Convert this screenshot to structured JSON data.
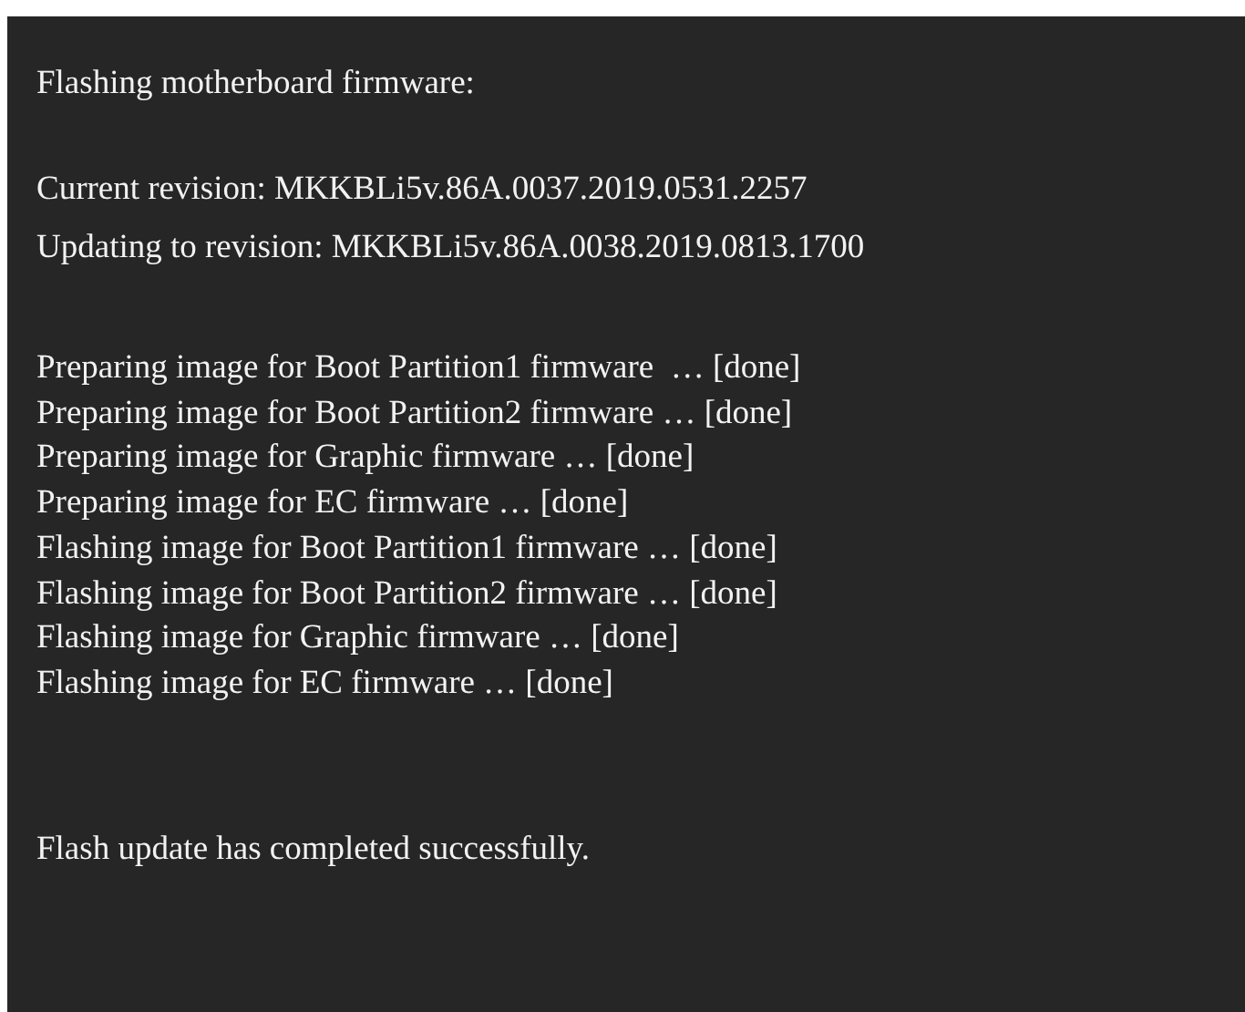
{
  "title": "Flashing motherboard firmware:",
  "revisions": [
    "Current revision: MKKBLi5v.86A.0037.2019.0531.2257",
    "Updating to revision: MKKBLi5v.86A.0038.2019.0813.1700"
  ],
  "steps": [
    "Preparing image for Boot Partition1 firmware  … [done]",
    "Preparing image for Boot Partition2 firmware … [done]",
    "Preparing image for Graphic firmware … [done]",
    "Preparing image for EC firmware … [done]",
    "Flashing image for Boot Partition1 firmware … [done]",
    "Flashing image for Boot Partition2 firmware … [done]",
    "Flashing image for Graphic firmware … [done]",
    "Flashing image for EC firmware … [done]"
  ],
  "result": "Flash update has completed successfully."
}
